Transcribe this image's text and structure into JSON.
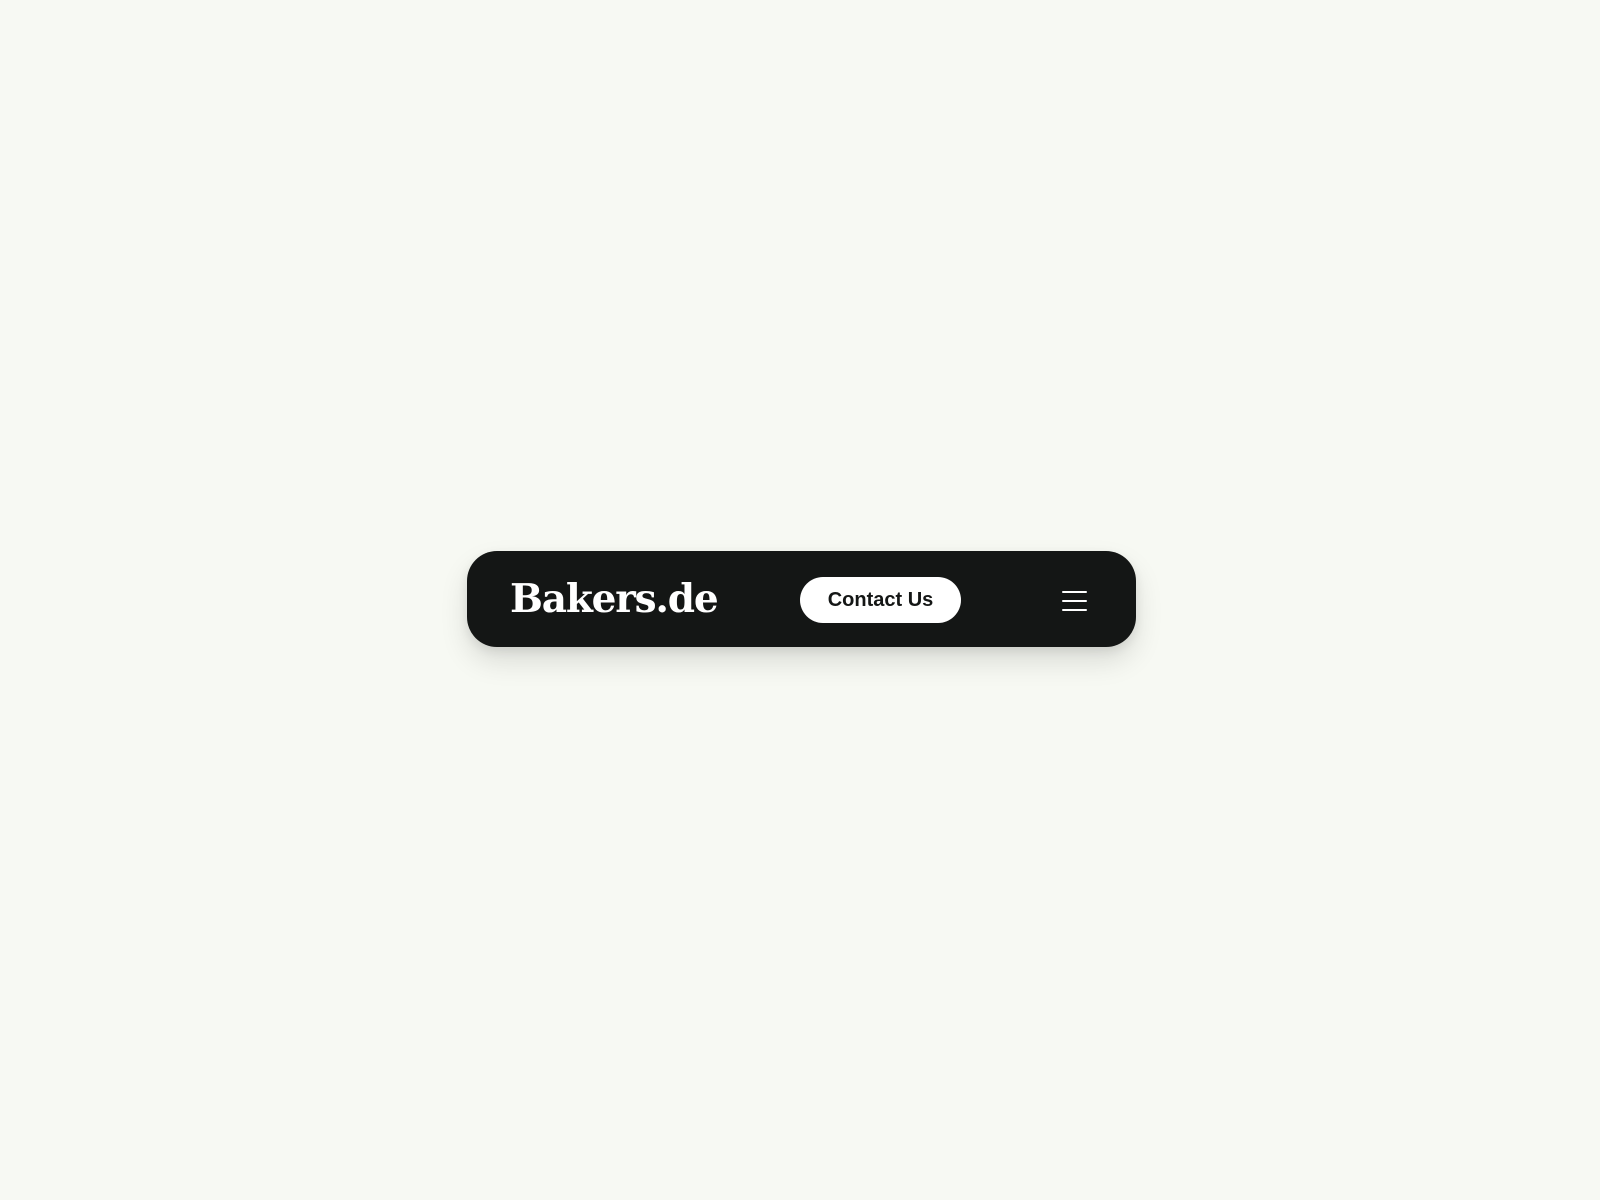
{
  "navbar": {
    "logo_text": "Bakers.de",
    "contact_button_label": "Contact Us",
    "menu_icon_name": "hamburger-menu-icon"
  },
  "colors": {
    "page_background": "#f7f9f3",
    "navbar_background": "#141615",
    "button_background": "#ffffff",
    "button_text": "#141615",
    "icon": "#ffffff"
  }
}
